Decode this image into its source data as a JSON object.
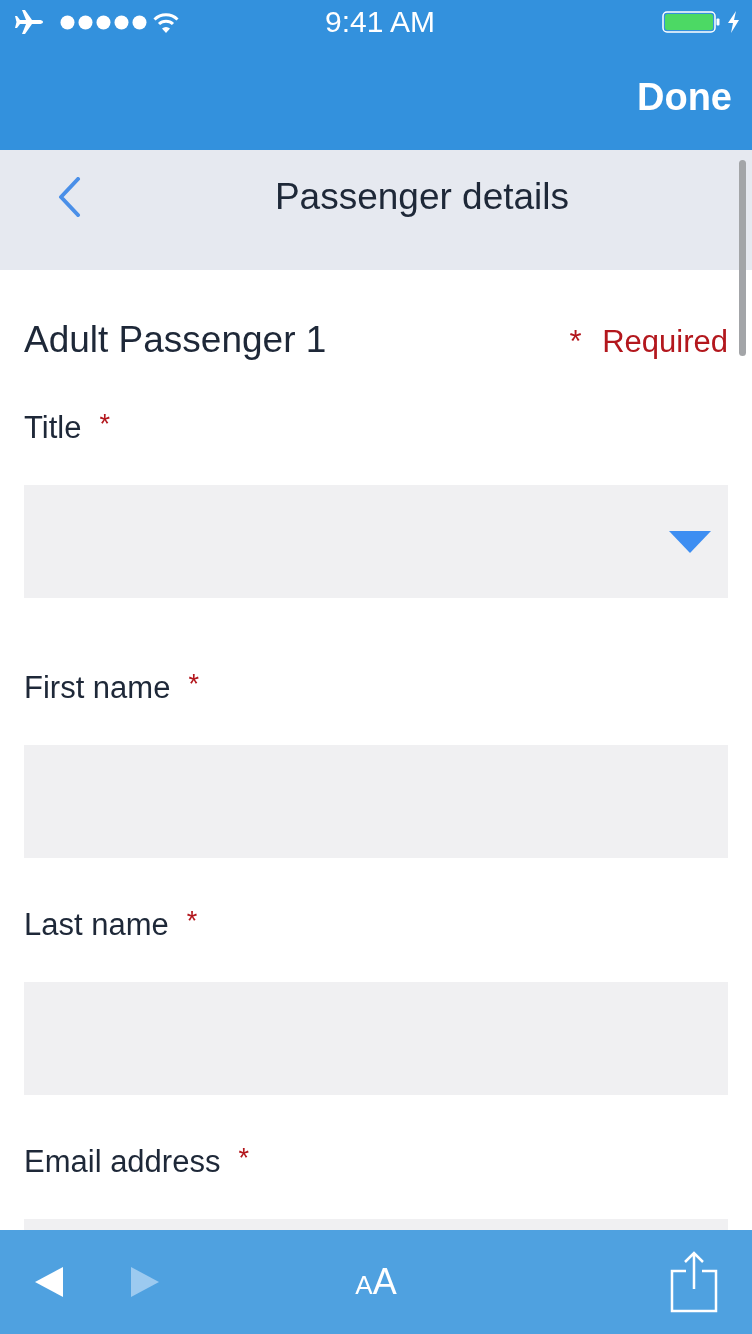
{
  "status_bar": {
    "time": "9:41 AM"
  },
  "top_bar": {
    "done_button": "Done"
  },
  "header": {
    "title": "Passenger details"
  },
  "form": {
    "heading": "Adult Passenger 1",
    "required_note": "* Required",
    "fields": [
      {
        "kind": "dropdown",
        "label": "Title",
        "required_mark": "*"
      },
      {
        "kind": "text",
        "label": "First name",
        "required_mark": "*"
      },
      {
        "kind": "text",
        "label": "Last name",
        "required_mark": "*"
      },
      {
        "kind": "text",
        "label": "Email address",
        "required_mark": "*"
      }
    ]
  },
  "toolbar": {
    "previous_button": {
      "disabled": false
    },
    "next_button": {
      "disabled": true
    },
    "text_size_button": {
      "small_letter": "A",
      "large_letter": "A"
    }
  }
}
